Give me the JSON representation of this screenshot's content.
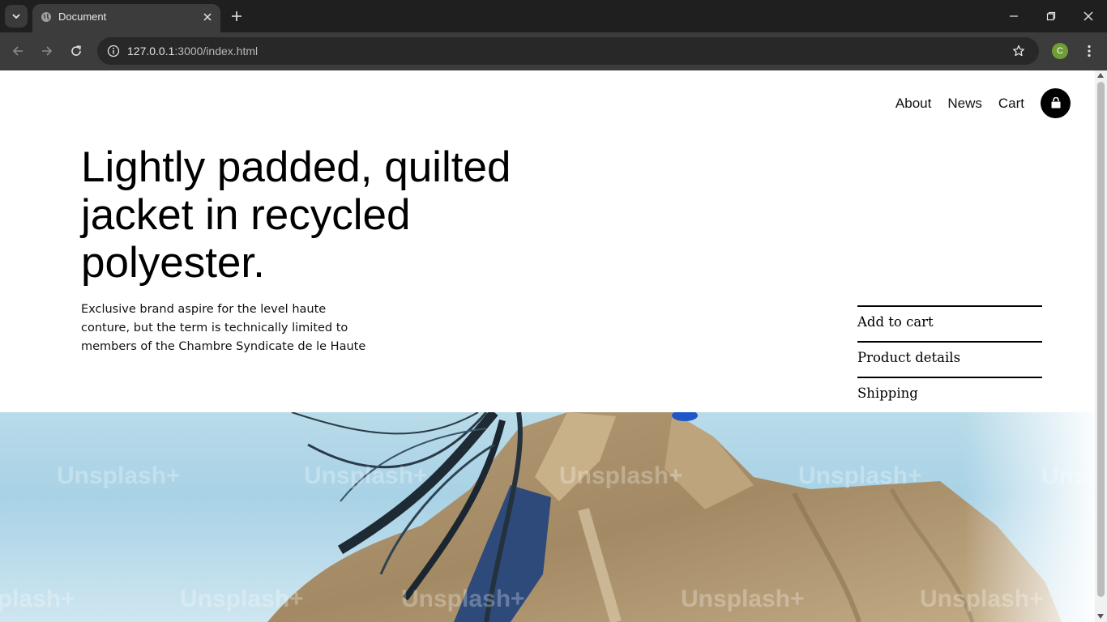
{
  "browser": {
    "tab_title": "Document",
    "url_host": "127.0.0.1",
    "url_path": ":3000/index.html",
    "profile_initial": "C",
    "profile_color": "#6e9e36"
  },
  "nav": {
    "links": [
      "About",
      "News",
      "Cart"
    ],
    "cart_icon": "shopping-bag-icon"
  },
  "hero": {
    "headline": "Lightly padded, quilted jacket in recycled polyester.",
    "description": "Exclusive brand aspire for the level haute conture, but the term is technically limited to members of the Chambre Syndicate de le Haute"
  },
  "actions": [
    "Add to cart",
    "Product details",
    "Shipping"
  ],
  "image": {
    "watermark": "Unsplash+"
  },
  "colors": {
    "accent": "#000000",
    "chrome_dark": "#1f1f1f",
    "chrome_toolbar": "#3c3c3c"
  }
}
